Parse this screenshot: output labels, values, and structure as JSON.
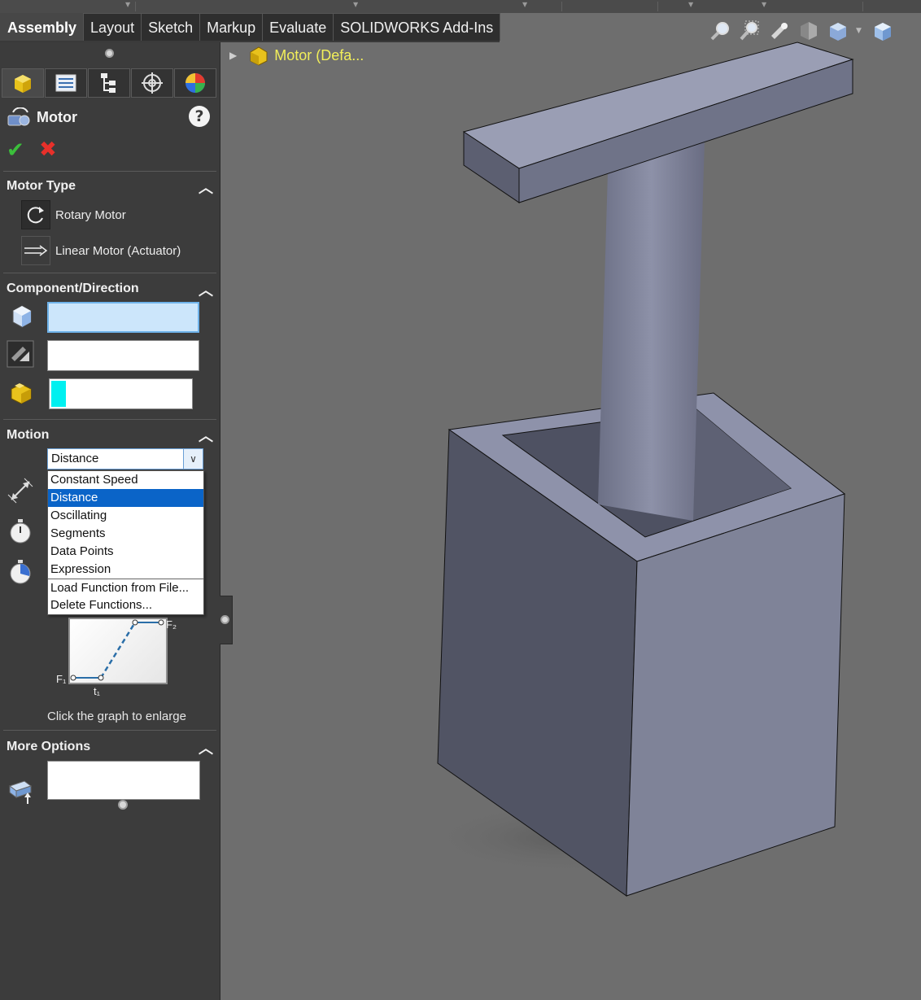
{
  "ribbon": {
    "tabs": [
      {
        "label": "Assembly",
        "active": true
      },
      {
        "label": "Layout"
      },
      {
        "label": "Sketch"
      },
      {
        "label": "Markup"
      },
      {
        "label": "Evaluate"
      },
      {
        "label": "SOLIDWORKS Add-Ins"
      }
    ]
  },
  "heads_up_toolbar": {
    "icons": [
      "zoom-to-fit-icon",
      "zoom-to-area-icon",
      "previous-view-icon",
      "section-view-icon",
      "view-orientation-icon",
      "display-style-icon"
    ]
  },
  "property_manager": {
    "tab_icons": [
      "motion-feature-icon",
      "property-manager-icon",
      "configuration-manager-icon",
      "dimxpert-icon",
      "display-manager-icon"
    ],
    "title": "Motor",
    "title_icon": "motor-icon",
    "help_label": "?",
    "ok_label": "✔",
    "cancel_label": "✖"
  },
  "motor_type": {
    "header": "Motor Type",
    "options": [
      {
        "label": "Rotary Motor",
        "icon": "rotary-motor-icon",
        "selected": true
      },
      {
        "label": "Linear Motor (Actuator)",
        "icon": "linear-motor-icon",
        "selected": false
      }
    ]
  },
  "component_direction": {
    "header": "Component/Direction",
    "fields": [
      {
        "icon": "component-face-icon",
        "value": "",
        "active": true
      },
      {
        "icon": "motor-direction-icon",
        "value": ""
      },
      {
        "icon": "component-to-move-icon",
        "value": ""
      }
    ]
  },
  "motion": {
    "header": "Motion",
    "function_selected": "Distance",
    "options": [
      "Constant Speed",
      "Distance",
      "Oscillating",
      "Segments",
      "Data Points",
      "Expression",
      "Load Function from File...",
      "Delete Functions..."
    ],
    "row_icons": [
      "displacement-icon",
      "start-time-icon",
      "duration-icon"
    ],
    "graph_caption": "Click the graph to enlarge",
    "graph_labels": {
      "f1": "F₁",
      "f2": "F₂",
      "t1": "t₁"
    }
  },
  "more_options": {
    "header": "More Options",
    "field_icon": "load-bearing-faces-icon",
    "value": ""
  },
  "feature_tree": {
    "root_label": "Motor  (Defa..."
  },
  "colors": {
    "panel_bg": "#3c3c3c",
    "viewport_bg": "#6e6e6e",
    "tree_text": "#f2ef5a",
    "selection": "#0a64c8",
    "active_field": "#cce6fb",
    "cyan_marker": "#00f0f0",
    "model_light": "#8e92aa",
    "model_dark": "#505363"
  }
}
